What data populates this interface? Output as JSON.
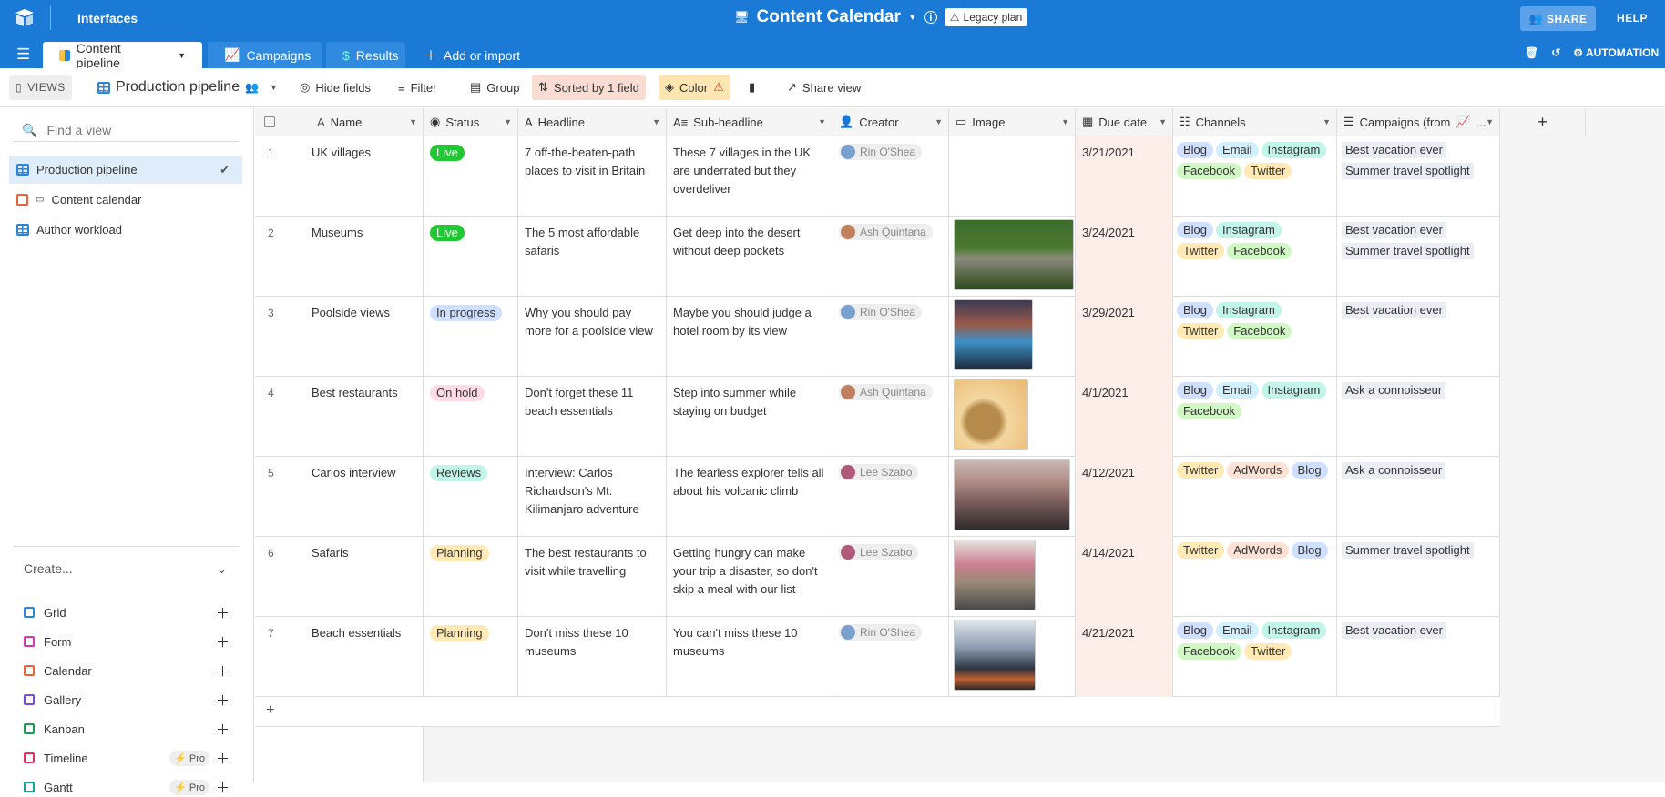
{
  "topbar": {
    "interfaces": "Interfaces",
    "base_title": "Content Calendar",
    "legacy": "Legacy plan",
    "share": "SHARE",
    "help": "HELP"
  },
  "tabs": [
    {
      "label": "Content pipeline"
    },
    {
      "label": "Campaigns"
    },
    {
      "label": "Results"
    }
  ],
  "add_import": "Add or import",
  "automations": "AUTOMATION",
  "toolbar": {
    "views": "VIEWS",
    "view_name": "Production pipeline",
    "hide_fields": "Hide fields",
    "filter": "Filter",
    "group": "Group",
    "sorted": "Sorted by 1 field",
    "color": "Color",
    "share_view": "Share view"
  },
  "sidebar": {
    "find_placeholder": "Find a view",
    "views": [
      {
        "label": "Production pipeline"
      },
      {
        "label": "Content calendar"
      },
      {
        "label": "Author workload"
      }
    ],
    "create": "Create...",
    "create_items": [
      {
        "label": "Grid",
        "color": "#2a87d8"
      },
      {
        "label": "Form",
        "color": "#d438b4"
      },
      {
        "label": "Calendar",
        "color": "#e9623a"
      },
      {
        "label": "Gallery",
        "color": "#7c4bd6"
      },
      {
        "label": "Kanban",
        "color": "#1b9e4a"
      },
      {
        "label": "Timeline",
        "color": "#e0305c",
        "pro": "Pro"
      },
      {
        "label": "Gantt",
        "color": "#13a397",
        "pro": "Pro"
      }
    ]
  },
  "columns": {
    "name": "Name",
    "status": "Status",
    "headline": "Headline",
    "subheadline": "Sub-headline",
    "creator": "Creator",
    "image": "Image",
    "due": "Due date",
    "channels": "Channels",
    "campaigns": "Campaigns (from",
    "campaigns_more": "..."
  },
  "add_column": "+",
  "add_row": "+",
  "rows": [
    {
      "num": "1",
      "name": "UK villages",
      "status": "Live",
      "headline": "7 off-the-beaten-path places to visit in Britain",
      "sub": "These 7 villages in the UK are underrated but they overdeliver",
      "creator": "Rin O'Shea",
      "due": "3/21/2021",
      "channels": [
        "Blog",
        "Email",
        "Instagram",
        "Facebook",
        "Twitter"
      ],
      "campaigns": [
        "Best vacation ever",
        "Summer travel spotlight"
      ]
    },
    {
      "num": "2",
      "name": "Museums",
      "status": "Live",
      "headline": "The 5 most affordable safaris",
      "sub": "Get deep into the desert without deep pockets",
      "creator": "Ash Quintana",
      "due": "3/24/2021",
      "channels": [
        "Blog",
        "Instagram",
        "Twitter",
        "Facebook"
      ],
      "campaigns": [
        "Best vacation ever",
        "Summer travel spotlight"
      ]
    },
    {
      "num": "3",
      "name": "Poolside views",
      "status": "In progress",
      "headline": "Why you should pay more for a poolside view",
      "sub": "Maybe you should judge a hotel room by its view",
      "creator": "Rin O'Shea",
      "due": "3/29/2021",
      "channels": [
        "Blog",
        "Instagram",
        "Twitter",
        "Facebook"
      ],
      "campaigns": [
        "Best vacation ever"
      ]
    },
    {
      "num": "4",
      "name": "Best restaurants",
      "status": "On hold",
      "headline": "Don't forget these 11 beach essentials",
      "sub": "Step into summer while staying on budget",
      "creator": "Ash Quintana",
      "due": "4/1/2021",
      "channels": [
        "Blog",
        "Email",
        "Instagram",
        "Facebook"
      ],
      "campaigns": [
        "Ask a connoisseur"
      ]
    },
    {
      "num": "5",
      "name": "Carlos interview",
      "status": "Reviews",
      "headline": "Interview: Carlos Richardson's Mt. Kilimanjaro adventure",
      "sub": "The fearless explorer tells all about his volcanic climb",
      "creator": "Lee Szabo",
      "due": "4/12/2021",
      "channels": [
        "Twitter",
        "AdWords",
        "Blog"
      ],
      "campaigns": [
        "Ask a connoisseur"
      ]
    },
    {
      "num": "6",
      "name": "Safaris",
      "status": "Planning",
      "headline": "The best restaurants to visit while travelling",
      "sub": "Getting hungry can make your trip a disaster, so don't skip a meal with our list",
      "creator": "Lee Szabo",
      "due": "4/14/2021",
      "channels": [
        "Twitter",
        "AdWords",
        "Blog"
      ],
      "campaigns": [
        "Summer travel spotlight"
      ]
    },
    {
      "num": "7",
      "name": "Beach essentials",
      "status": "Planning",
      "headline": "Don't miss these 10 museums",
      "sub": "You can't miss these 10 museums",
      "creator": "Rin O'Shea",
      "due": "4/21/2021",
      "channels": [
        "Blog",
        "Email",
        "Instagram",
        "Facebook",
        "Twitter"
      ],
      "campaigns": [
        "Best vacation ever"
      ]
    }
  ],
  "colors": {
    "Live": "#20c933",
    "In progress": "#cfdfff",
    "On hold": "#ffdce5",
    "Reviews": "#c2f5e9",
    "Planning": "#ffeab6",
    "Blog": "#cfdfff",
    "Email": "#d0f0fd",
    "Instagram": "#c2f5e9",
    "Facebook": "#d1f7c4",
    "Twitter": "#ffeab6",
    "AdWords": "#fee2d5"
  }
}
